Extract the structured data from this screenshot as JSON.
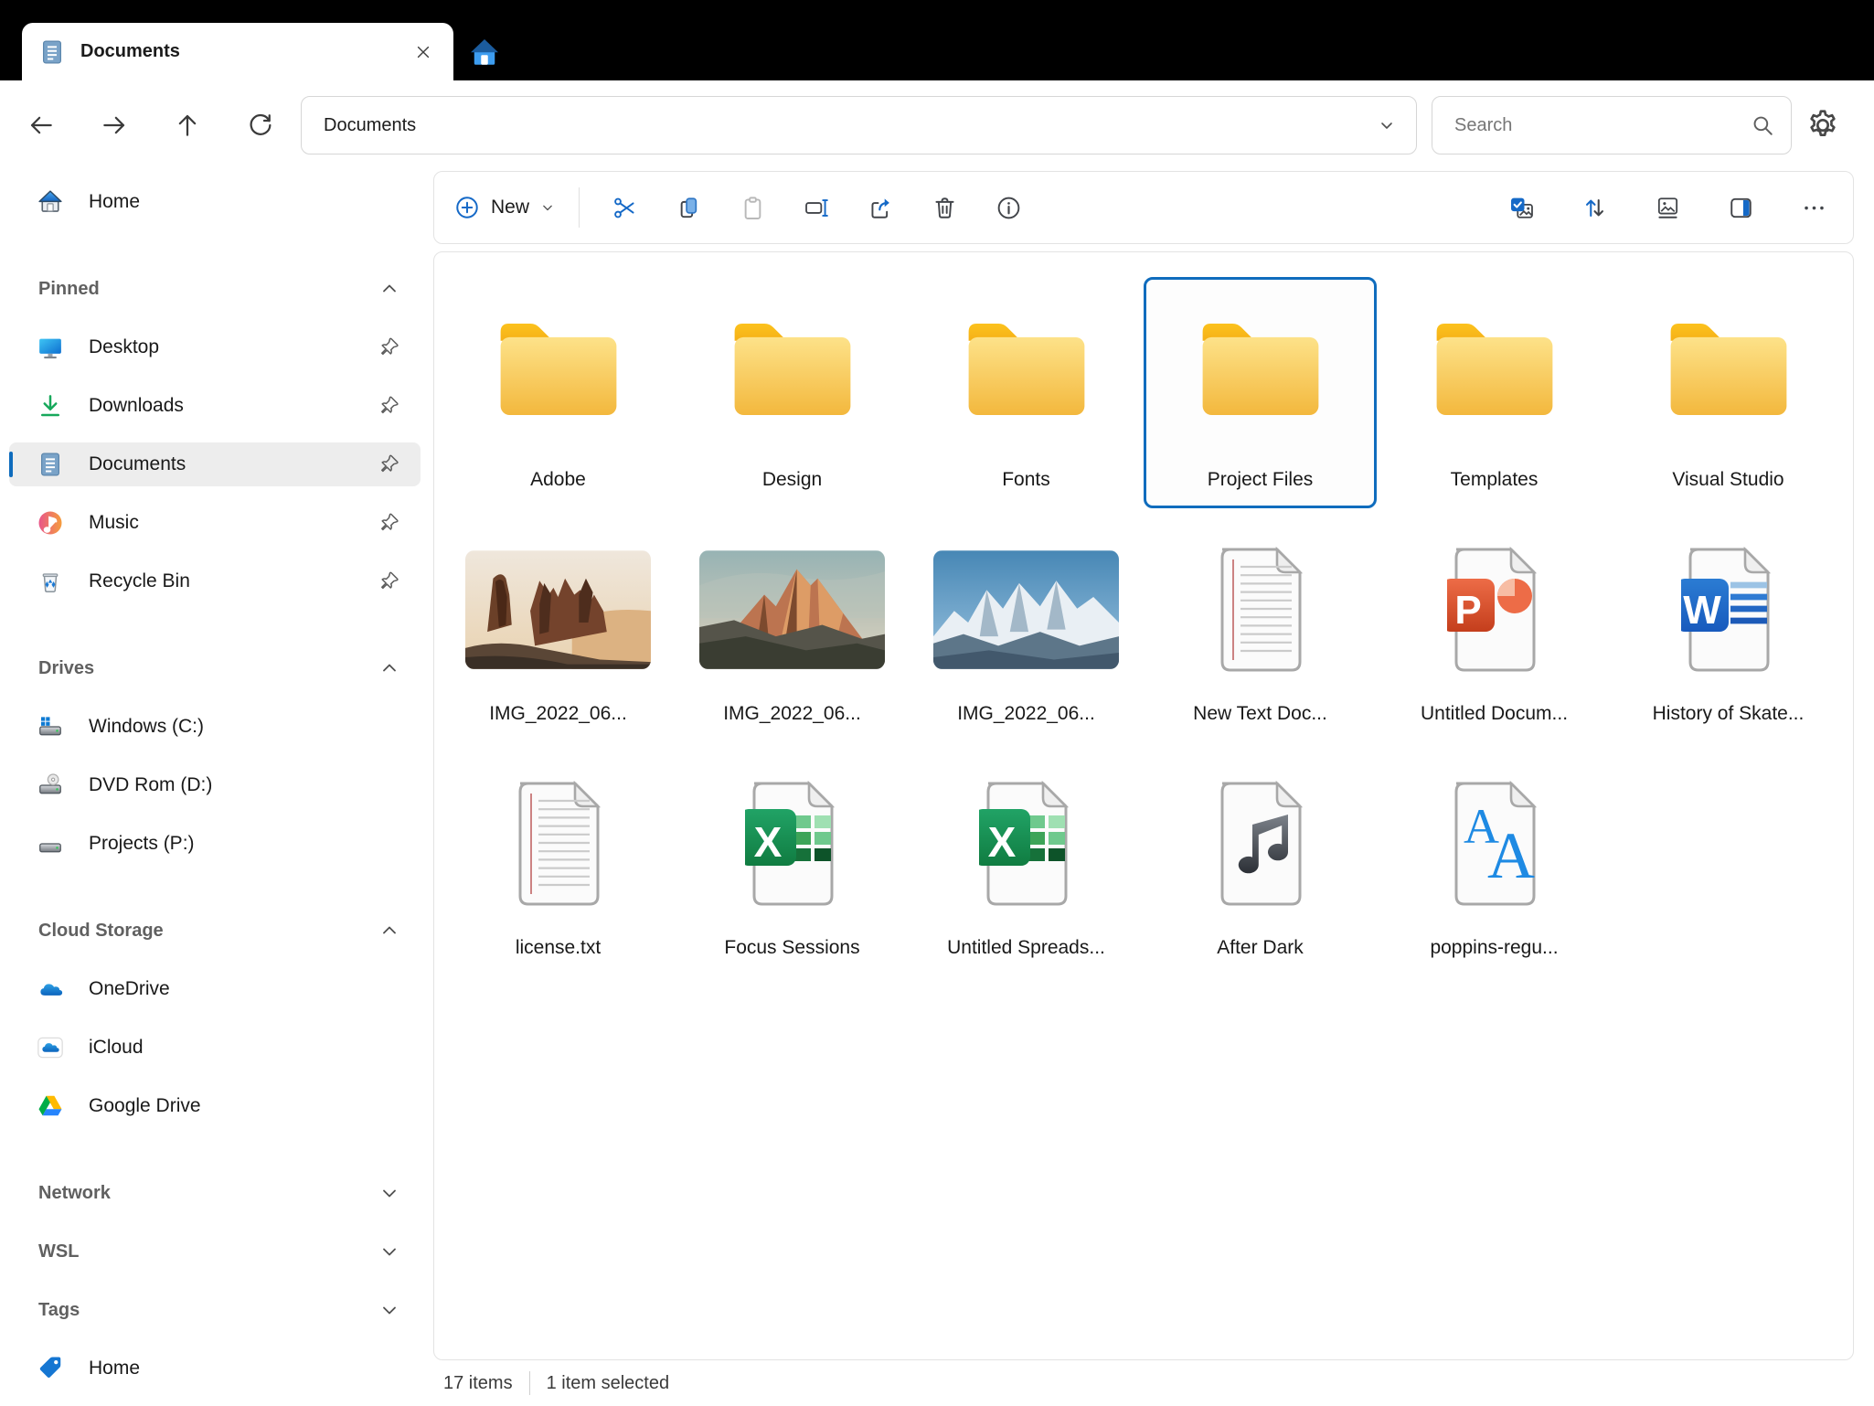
{
  "tab": {
    "title": "Documents"
  },
  "toolbar": {
    "address": "Documents",
    "search_placeholder": "Search"
  },
  "sidebar": {
    "home": {
      "label": "Home"
    },
    "pinned": {
      "header": "Pinned",
      "items": [
        {
          "label": "Desktop"
        },
        {
          "label": "Downloads"
        },
        {
          "label": "Documents"
        },
        {
          "label": "Music"
        },
        {
          "label": "Recycle Bin"
        }
      ]
    },
    "drives": {
      "header": "Drives",
      "items": [
        {
          "label": "Windows (C:)"
        },
        {
          "label": "DVD Rom (D:)"
        },
        {
          "label": "Projects (P:)"
        }
      ]
    },
    "cloud": {
      "header": "Cloud Storage",
      "items": [
        {
          "label": "OneDrive"
        },
        {
          "label": "iCloud"
        },
        {
          "label": "Google Drive"
        }
      ]
    },
    "network": {
      "header": "Network"
    },
    "wsl": {
      "header": "WSL"
    },
    "tags": {
      "header": "Tags",
      "items": [
        {
          "label": "Home"
        }
      ]
    }
  },
  "commandbar": {
    "new_label": "New"
  },
  "files": [
    {
      "name": "Adobe",
      "type": "folder"
    },
    {
      "name": "Design",
      "type": "folder"
    },
    {
      "name": "Fonts",
      "type": "folder"
    },
    {
      "name": "Project Files",
      "type": "folder",
      "selected": true
    },
    {
      "name": "Templates",
      "type": "folder"
    },
    {
      "name": "Visual Studio",
      "type": "folder"
    },
    {
      "name": "IMG_2022_06...",
      "type": "image"
    },
    {
      "name": "IMG_2022_06...",
      "type": "image"
    },
    {
      "name": "IMG_2022_06...",
      "type": "image"
    },
    {
      "name": "New Text Doc...",
      "type": "text"
    },
    {
      "name": "Untitled Docum...",
      "type": "powerpoint"
    },
    {
      "name": "History of Skate...",
      "type": "word"
    },
    {
      "name": "license.txt",
      "type": "text"
    },
    {
      "name": "Focus Sessions",
      "type": "excel"
    },
    {
      "name": "Untitled Spreads...",
      "type": "excel"
    },
    {
      "name": "After Dark",
      "type": "audio"
    },
    {
      "name": "poppins-regu...",
      "type": "font"
    }
  ],
  "statusbar": {
    "count": "17 items",
    "selected": "1 item selected"
  },
  "colors": {
    "accent": "#0f6cbd",
    "folder": "#f6bf47"
  }
}
